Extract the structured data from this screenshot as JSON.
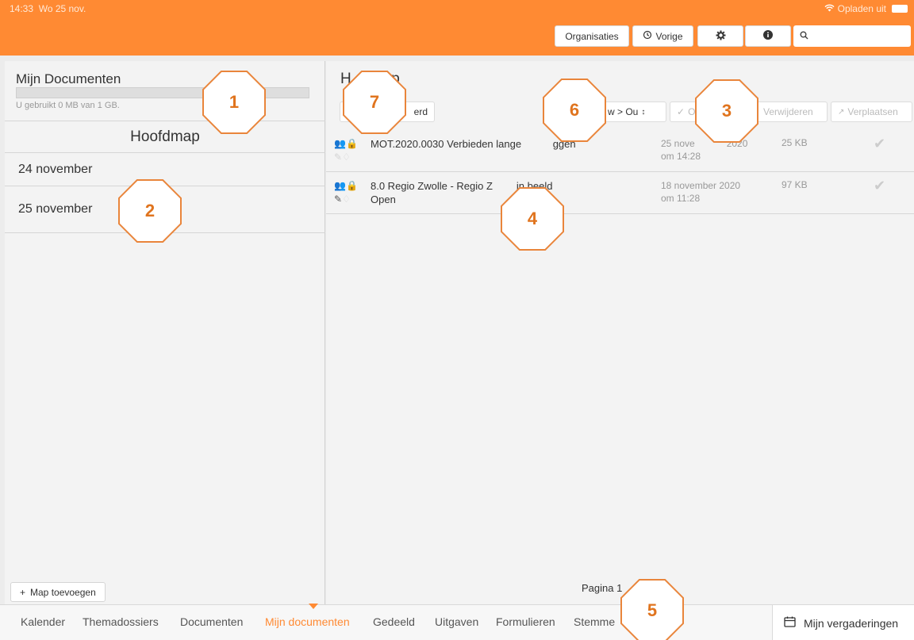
{
  "status": {
    "time": "14:33",
    "day": "Wo 25 nov.",
    "right_text": "Opladen uit",
    "wifi_icon": "wifi-icon",
    "battery_icon": "battery-icon"
  },
  "toolbar": {
    "organisaties": "Organisaties",
    "vorige": "Vorige",
    "settings_icon": "gear-icon",
    "info_icon": "info-icon",
    "search_icon": "search-icon",
    "search_placeholder": ""
  },
  "left_panel": {
    "title": "Mijn Documenten",
    "usage_text": "U gebruikt 0 MB van 1 GB.",
    "usage_fraction": 0,
    "folder_header": "Hoofdmap",
    "folders": [
      "24 november",
      "25 november"
    ],
    "add_folder": "Map toevoegen"
  },
  "right_panel": {
    "title": "Hoofdmap",
    "title_visible_left": "H",
    "title_visible_right": "ap",
    "first_action_visible": "erd",
    "sort_label": "w > Ou",
    "check_label": "O",
    "delete_label": "Verwijderen",
    "move_label": "Verplaatsen",
    "documents": [
      {
        "title_a": "MOT.2020.0030 Verbieden lange ",
        "title_b": "ggen",
        "date_a": "25 nove",
        "date_b": "2020",
        "date_line2": "om 14:28",
        "size": "25 KB"
      },
      {
        "title_a": "8.0 Regio Zwolle - Regio Z",
        "title_b": "in beeld",
        "title_line2": "Open",
        "date_line1": "18 november 2020",
        "date_line2": "om 11:28",
        "size": "97 KB"
      }
    ],
    "pagination": "Pagina 1"
  },
  "bottom_nav": {
    "items": [
      "Kalender",
      "Themadossiers",
      "Documenten",
      "Mijn documenten",
      "Gedeeld",
      "Uitgaven",
      "Formulieren",
      "Stemme"
    ],
    "active_index": 3,
    "meetings": "Mijn vergaderingen"
  },
  "callouts": [
    "1",
    "2",
    "3",
    "4",
    "5",
    "6",
    "7"
  ],
  "colors": {
    "accent": "#ff8a33",
    "callout_border": "#e9853b",
    "callout_text": "#e0741e"
  }
}
